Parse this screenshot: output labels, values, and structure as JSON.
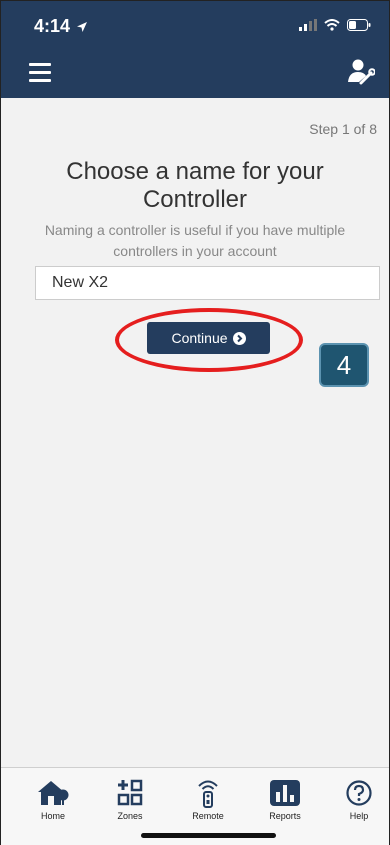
{
  "status_bar": {
    "time": "4:14"
  },
  "header": {
    "menu_icon": "hamburger-icon",
    "tools_icon": "user-tools-icon"
  },
  "main": {
    "step": "Step 1 of 8",
    "title": "Choose a name for your Controller",
    "subtitle": "Naming a controller is useful if you have multiple controllers in your account",
    "name_input": {
      "value": "New X2"
    },
    "continue_label": "Continue",
    "annotation_badge": "4"
  },
  "tabs": [
    {
      "label": "Home",
      "icon": "home-icon"
    },
    {
      "label": "Zones",
      "icon": "zones-icon"
    },
    {
      "label": "Remote",
      "icon": "remote-icon"
    },
    {
      "label": "Reports",
      "icon": "reports-icon"
    },
    {
      "label": "Help",
      "icon": "help-icon"
    }
  ],
  "colors": {
    "brand": "#243d5e",
    "annotation": "#e51e1e",
    "badge": "#1f5570"
  }
}
